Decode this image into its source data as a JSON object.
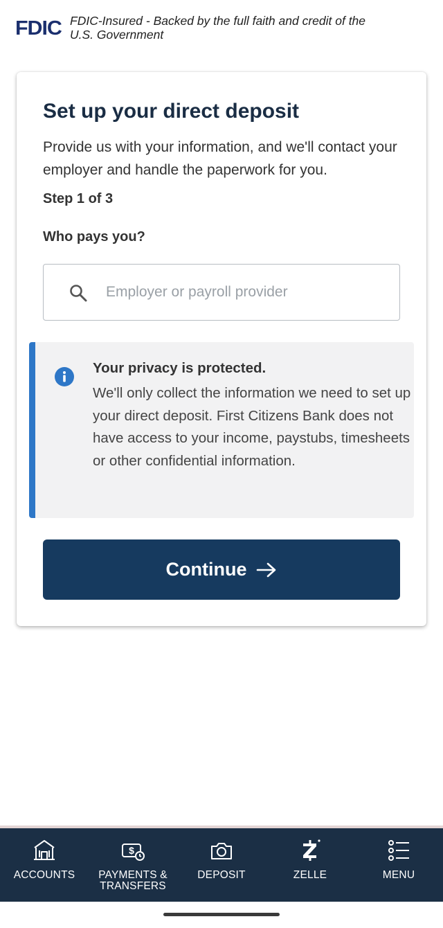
{
  "fdic": {
    "logo": "FDIC",
    "text": "FDIC-Insured - Backed by the full faith and credit of the U.S. Government"
  },
  "card": {
    "title": "Set up your direct deposit",
    "description": "Provide us with your information, and we'll contact your employer and handle the paperwork for you.",
    "step": "Step 1 of 3",
    "question": "Who pays you?",
    "search": {
      "placeholder": "Employer or payroll provider",
      "value": ""
    },
    "privacy": {
      "title": "Your privacy is protected.",
      "body": "We'll only collect the information we need to set up your direct deposit. First Citizens Bank does not have access to your income, paystubs, timesheets or other confidential information."
    },
    "continue_label": "Continue"
  },
  "nav": {
    "items": [
      {
        "label": "ACCOUNTS",
        "icon": "bank-icon"
      },
      {
        "label": "PAYMENTS & TRANSFERS",
        "icon": "money-transfer-icon"
      },
      {
        "label": "DEPOSIT",
        "icon": "camera-icon"
      },
      {
        "label": "ZELLE",
        "icon": "zelle-icon"
      },
      {
        "label": "MENU",
        "icon": "menu-list-icon"
      }
    ]
  },
  "colors": {
    "primary": "#163a5f",
    "nav_bg": "#1b2f45",
    "info_accent": "#2e77c7",
    "privacy_bg": "#f2f2f3"
  }
}
